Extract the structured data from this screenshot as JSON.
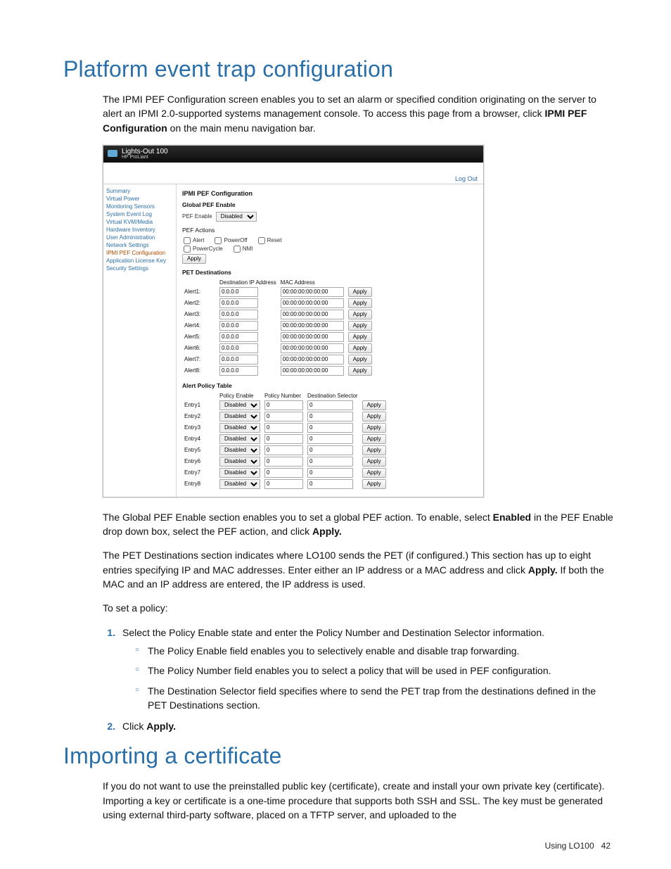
{
  "section1": {
    "title": "Platform event trap configuration",
    "intro_pre": "The IPMI PEF Configuration screen enables you to set an alarm or specified condition originating on the server to alert an IPMI 2.0-supported systems management console. To access this page from a browser, click ",
    "intro_bold": "IPMI PEF Configuration",
    "intro_post": " on the main menu navigation bar.",
    "para2_pre": "The Global PEF Enable section enables you to set a global PEF action. To enable, select ",
    "para2_bold1": "Enabled",
    "para2_mid": " in the PEF Enable drop down box, select the PEF action, and click ",
    "para2_bold2": "Apply.",
    "para3_pre": "The PET Destinations section indicates where LO100 sends the PET (if configured.) This section has up to eight entries specifying IP and MAC addresses. Enter either an IP address or a MAC address and click ",
    "para3_bold": "Apply.",
    "para3_post": " If both the MAC and an IP address are entered, the IP address is used.",
    "para4": "To set a policy:",
    "step1": "Select the Policy Enable state and enter the Policy Number and Destination Selector information.",
    "step1_sub": [
      "The Policy Enable field enables you to selectively enable and disable trap forwarding.",
      "The Policy Number field enables you to select a policy that will be used in PEF configuration.",
      "The Destination Selector field specifies where to send the PET trap from the destinations defined in the PET Destinations section."
    ],
    "step2_pre": "Click ",
    "step2_bold": "Apply."
  },
  "section2": {
    "title": "Importing a certificate",
    "para": "If you do not want to use the preinstalled public key (certificate), create and install your own private key (certificate). Importing a key or certificate is a one-time procedure that supports both SSH and SSL. The key must be generated using external third-party software, placed on a TFTP server, and uploaded to the"
  },
  "footer": {
    "text": "Using LO100",
    "page": "42"
  },
  "app": {
    "brand": "Lights-Out 100",
    "brandsub": "HP ProLiant",
    "logout": "Log Out",
    "sidebar": [
      "Summary",
      "Virtual Power",
      "Monitoring Sensors",
      "System Event Log",
      "Virtual KVM/Media",
      "Hardware Inventory",
      "User Administration",
      "Network Settings",
      "IPMI PEF Configuration",
      "Application License Key",
      "Security Settings"
    ],
    "sidebar_active_index": 8,
    "page_title": "IPMI PEF Configuration",
    "global_label": "Global PEF Enable",
    "pef_enable_label": "PEF Enable",
    "pef_enable_value": "Disabled",
    "pef_actions_label": "PEF Actions",
    "pef_actions": [
      "Alert",
      "PowerOff",
      "Reset",
      "PowerCycle",
      "NMI"
    ],
    "apply": "Apply",
    "pet_label": "PET Destinations",
    "pet_headers": {
      "ip": "Destination IP Address",
      "mac": "MAC Address"
    },
    "pet_rows": [
      {
        "name": "Alert1:",
        "ip": "0.0.0.0",
        "mac": "00:00:00:00:00:00"
      },
      {
        "name": "Alert2:",
        "ip": "0.0.0.0",
        "mac": "00:00:00:00:00:00"
      },
      {
        "name": "Alert3:",
        "ip": "0.0.0.0",
        "mac": "00:00:00:00:00:00"
      },
      {
        "name": "Alert4:",
        "ip": "0.0.0.0",
        "mac": "00:00:00:00:00:00"
      },
      {
        "name": "Alert5:",
        "ip": "0.0.0.0",
        "mac": "00:00:00:00:00:00"
      },
      {
        "name": "Alert6:",
        "ip": "0.0.0.0",
        "mac": "00:00:00:00:00:00"
      },
      {
        "name": "Alert7:",
        "ip": "0.0.0.0",
        "mac": "00:00:00:00:00:00"
      },
      {
        "name": "Alert8:",
        "ip": "0.0.0.0",
        "mac": "00:00:00:00:00:00"
      }
    ],
    "policy_label": "Alert Policy Table",
    "policy_headers": {
      "enable": "Policy Enable",
      "number": "Policy Number",
      "selector": "Destination Selector"
    },
    "policy_rows": [
      {
        "name": "Entry1",
        "enable": "Disabled",
        "num": "0",
        "sel": "0"
      },
      {
        "name": "Entry2",
        "enable": "Disabled",
        "num": "0",
        "sel": "0"
      },
      {
        "name": "Entry3",
        "enable": "Disabled",
        "num": "0",
        "sel": "0"
      },
      {
        "name": "Entry4",
        "enable": "Disabled",
        "num": "0",
        "sel": "0"
      },
      {
        "name": "Entry5",
        "enable": "Disabled",
        "num": "0",
        "sel": "0"
      },
      {
        "name": "Entry6",
        "enable": "Disabled",
        "num": "0",
        "sel": "0"
      },
      {
        "name": "Entry7",
        "enable": "Disabled",
        "num": "0",
        "sel": "0"
      },
      {
        "name": "Entry8",
        "enable": "Disabled",
        "num": "0",
        "sel": "0"
      }
    ]
  }
}
